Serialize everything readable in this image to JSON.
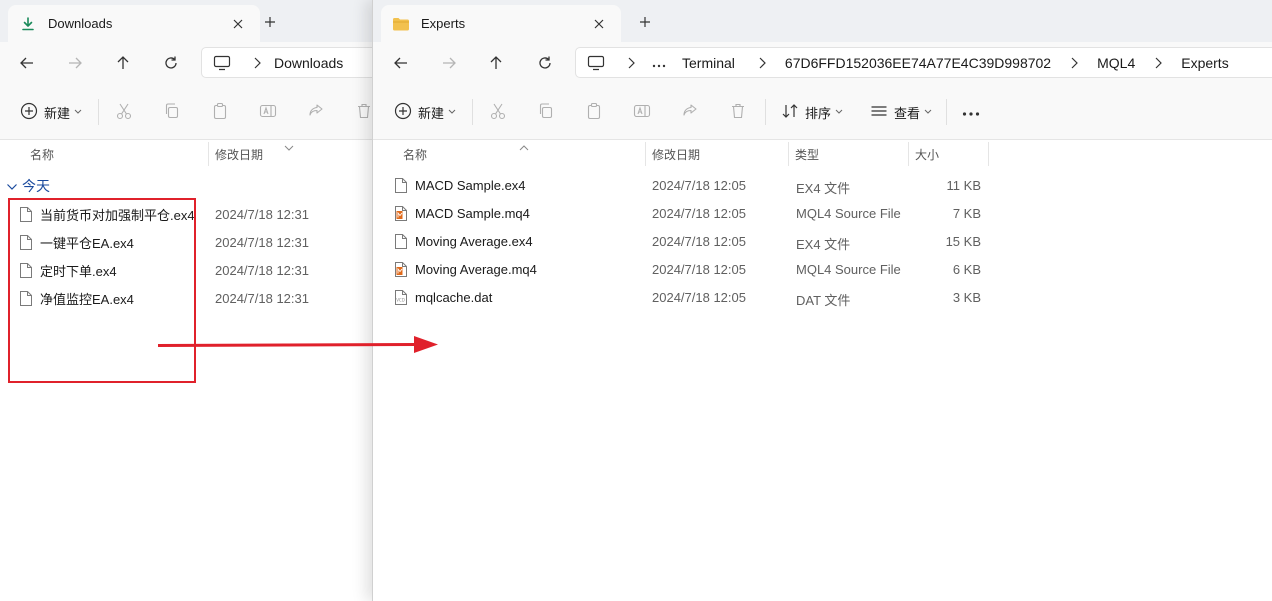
{
  "left_window": {
    "tab_title": "Downloads",
    "breadcrumb": [
      "Downloads"
    ],
    "toolbar": {
      "new_label": "新建"
    },
    "columns": {
      "name": "名称",
      "date": "修改日期"
    },
    "group_label": "今天",
    "files": [
      {
        "name": "当前货币对加强制平仓.ex4",
        "date": "2024/7/18 12:31"
      },
      {
        "name": "一键平仓EA.ex4",
        "date": "2024/7/18 12:31"
      },
      {
        "name": "定时下单.ex4",
        "date": "2024/7/18 12:31"
      },
      {
        "name": "净值监控EA.ex4",
        "date": "2024/7/18 12:31"
      }
    ]
  },
  "right_window": {
    "tab_title": "Experts",
    "breadcrumb": [
      "Terminal",
      "67D6FFD152036EE74A77E4C39D998702",
      "MQL4",
      "Experts"
    ],
    "toolbar": {
      "new_label": "新建",
      "sort_label": "排序",
      "view_label": "查看"
    },
    "columns": {
      "name": "名称",
      "date": "修改日期",
      "type": "类型",
      "size": "大小"
    },
    "files": [
      {
        "name": "MACD Sample.ex4",
        "date": "2024/7/18 12:05",
        "type": "EX4 文件",
        "size": "11 KB",
        "icon": "blank-file-icon"
      },
      {
        "name": "MACD Sample.mq4",
        "date": "2024/7/18 12:05",
        "type": "MQL4 Source File",
        "size": "7 KB",
        "icon": "mql4-file-icon"
      },
      {
        "name": "Moving Average.ex4",
        "date": "2024/7/18 12:05",
        "type": "EX4 文件",
        "size": "15 KB",
        "icon": "blank-file-icon"
      },
      {
        "name": "Moving Average.mq4",
        "date": "2024/7/18 12:05",
        "type": "MQL4 Source File",
        "size": "6 KB",
        "icon": "mql4-file-icon"
      },
      {
        "name": "mqlcache.dat",
        "date": "2024/7/18 12:05",
        "type": "DAT 文件",
        "size": "3 KB",
        "icon": "vcd-file-icon"
      }
    ]
  },
  "colors": {
    "download_accent": "#1a8a5a",
    "folder_yellow": "#f2c14e",
    "highlight_red": "#e0212b",
    "group_blue": "#1a4a9e",
    "mql4_orange": "#e06a1b"
  }
}
